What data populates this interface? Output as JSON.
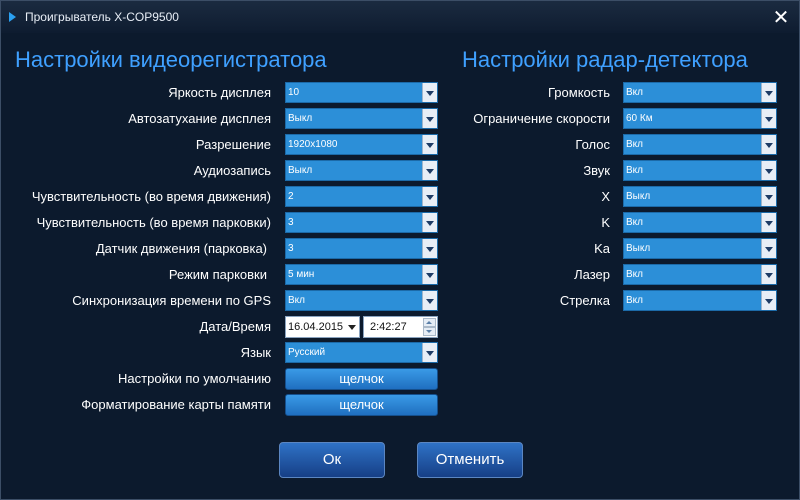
{
  "window": {
    "title": "Проигрыватель X-COP9500",
    "close_symbol": "✕",
    "play_icon": "play-icon"
  },
  "video": {
    "section_title": "Настройки видеорегистратора",
    "brightness": {
      "label": "Яркость дисплея",
      "value": "10"
    },
    "auto_dim": {
      "label": "Автозатухание дисплея",
      "value": "Выкл"
    },
    "resolution": {
      "label": "Разрешение",
      "value": "1920x1080"
    },
    "audio": {
      "label": "Аудиозапись",
      "value": "Выкл"
    },
    "sens_driving": {
      "label": "Чувствительность (во время движения)",
      "value": "2"
    },
    "sens_parking": {
      "label": "Чувствительность (во время парковки)",
      "value": "3"
    },
    "motion_sensor": {
      "label": "Датчик движения (парковка)",
      "value": "3"
    },
    "parking_mode": {
      "label": "Режим парковки",
      "value": "5 мин"
    },
    "gps_sync": {
      "label": "Синхронизация времени по GPS",
      "value": "Вкл"
    },
    "datetime": {
      "label": "Дата/Время",
      "date": "16.04.2015",
      "time": "2:42:27"
    },
    "language": {
      "label": "Язык",
      "value": "Русский"
    },
    "defaults": {
      "label": "Настройки по умолчанию",
      "button": "щелчок"
    },
    "format": {
      "label": "Форматирование карты памяти",
      "button": "щелчок"
    }
  },
  "radar": {
    "section_title": "Настройки радар-детектора",
    "volume": {
      "label": "Громкость",
      "value": "Вкл"
    },
    "speed_limit": {
      "label": "Ограничение скорости",
      "value": "60 Км"
    },
    "voice": {
      "label": "Голос",
      "value": "Вкл"
    },
    "sound": {
      "label": "Звук",
      "value": "Вкл"
    },
    "band_x": {
      "label": "X",
      "value": "Выкл"
    },
    "band_k": {
      "label": "K",
      "value": "Вкл"
    },
    "band_ka": {
      "label": "Ka",
      "value": "Выкл"
    },
    "laser": {
      "label": "Лазер",
      "value": "Вкл"
    },
    "strelka": {
      "label": "Стрелка",
      "value": "Вкл"
    }
  },
  "footer": {
    "ok_label": "Ок",
    "cancel_label": "Отменить"
  },
  "colors": {
    "accent": "#3fa0ff",
    "dropdown": "#2c8fd8",
    "background": "#0c1a2d"
  }
}
